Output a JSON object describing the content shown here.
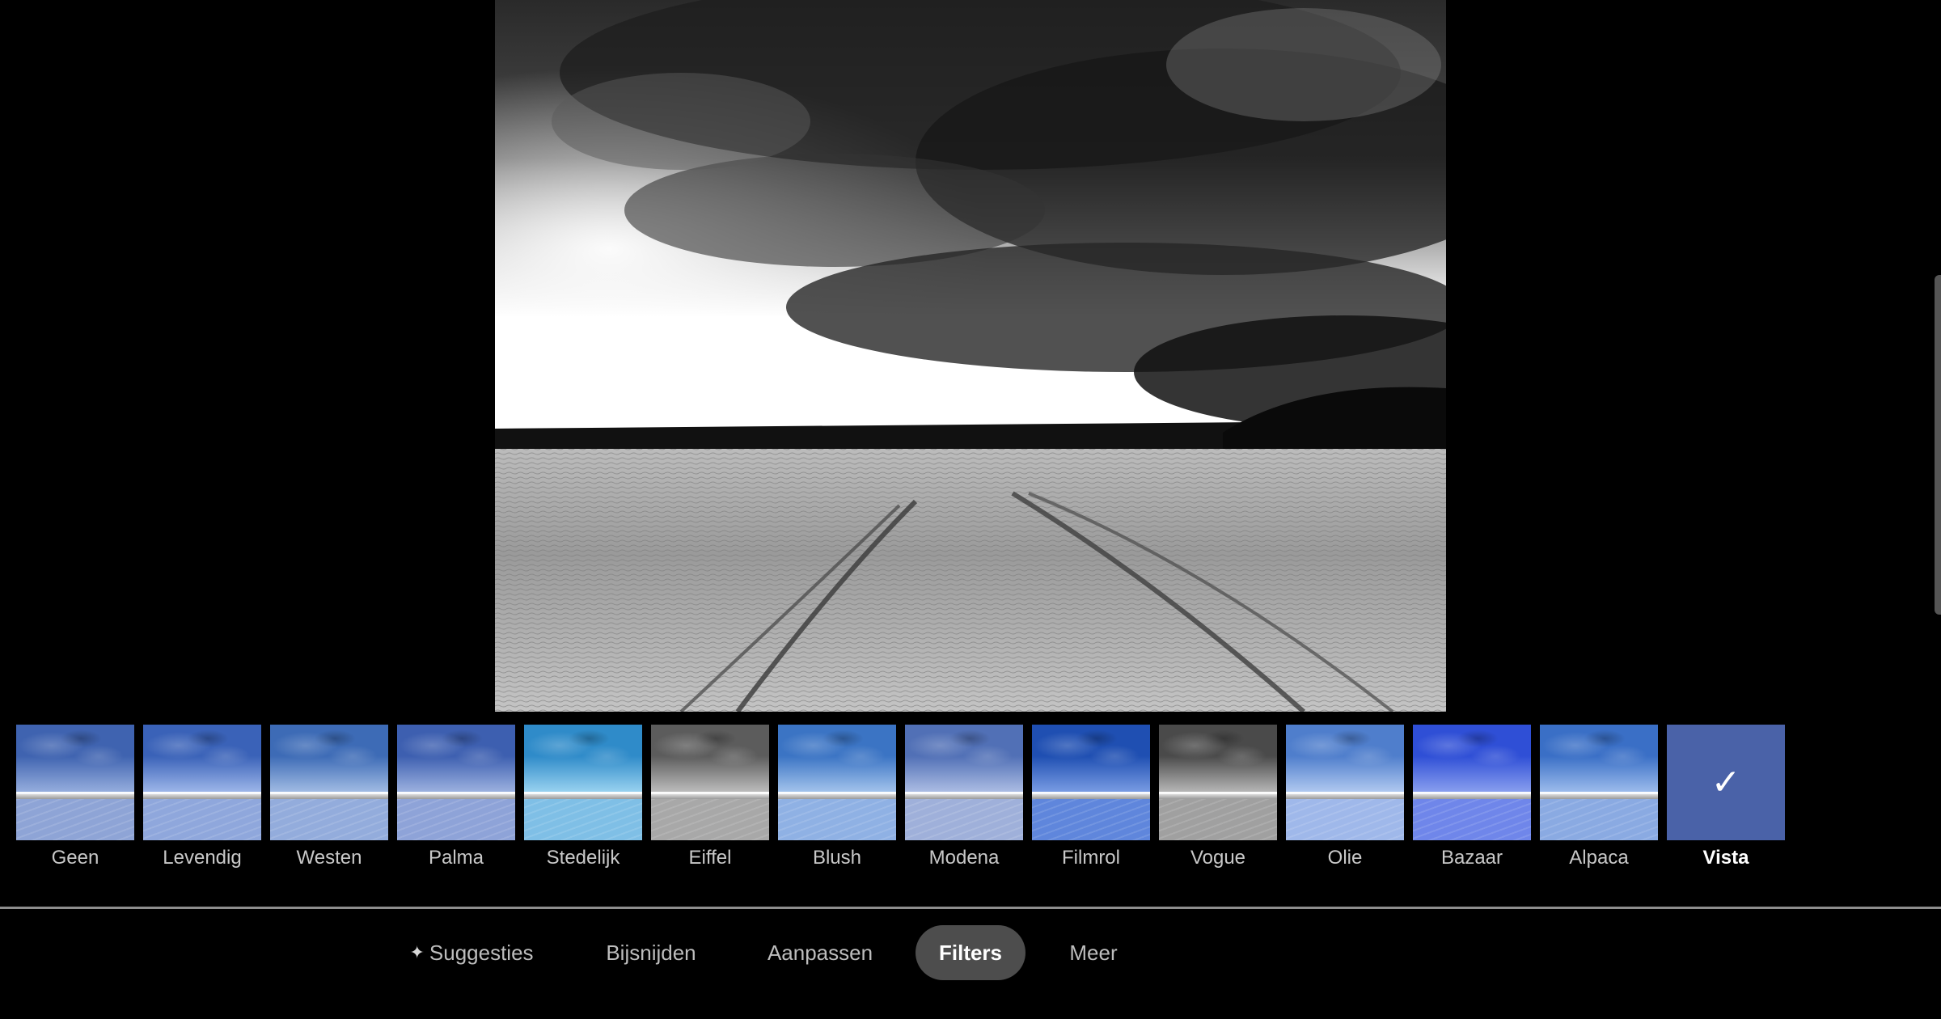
{
  "photo": {
    "subject": "black-and-white snowy field with footprints under dramatic clouds"
  },
  "filters": [
    {
      "label": "Geen",
      "sky": "#3f63b0",
      "sky2": "#9bb2e0",
      "ground": "#8ea4d6"
    },
    {
      "label": "Levendig",
      "sky": "#3a62b8",
      "sky2": "#a3bbec",
      "ground": "#8fa7dc"
    },
    {
      "label": "Westen",
      "sky": "#3d6bb6",
      "sky2": "#a7c0e6",
      "ground": "#93acdc"
    },
    {
      "label": "Palma",
      "sky": "#3d5fb0",
      "sky2": "#a2b6e2",
      "ground": "#8ea3d8"
    },
    {
      "label": "Stedelijk",
      "sky": "#2f8bc9",
      "sky2": "#9fd6f2",
      "ground": "#7fbfe6"
    },
    {
      "label": "Eiffel",
      "sky": "#5c5c5c",
      "sky2": "#c2c2c2",
      "ground": "#a8a8a8"
    },
    {
      "label": "Blush",
      "sky": "#3b74c4",
      "sky2": "#a9c8ee",
      "ground": "#8fb1e4"
    },
    {
      "label": "Modena",
      "sky": "#5170b6",
      "sky2": "#b1c1e6",
      "ground": "#9fb0da"
    },
    {
      "label": "Filmrol",
      "sky": "#1f4fb2",
      "sky2": "#7ea0e6",
      "ground": "#5f86dc"
    },
    {
      "label": "Vogue",
      "sky": "#4a4a4a",
      "sky2": "#bdbdbd",
      "ground": "#a0a0a0"
    },
    {
      "label": "Olie",
      "sky": "#4f7ecc",
      "sky2": "#b6cdf2",
      "ground": "#9fb8ea"
    },
    {
      "label": "Bazaar",
      "sky": "#2f4fd6",
      "sky2": "#8ea3f0",
      "ground": "#6f86ea"
    },
    {
      "label": "Alpaca",
      "sky": "#3a6fc6",
      "sky2": "#a2c0ee",
      "ground": "#8aaae2"
    }
  ],
  "selected_filter": {
    "label": "Vista",
    "check_icon": "✓",
    "color": "#4a62a8"
  },
  "toolbar": {
    "suggestions_icon": "✦",
    "suggestions": "Suggesties",
    "crop": "Bijsnijden",
    "adjust": "Aanpassen",
    "filters": "Filters",
    "more": "Meer"
  }
}
